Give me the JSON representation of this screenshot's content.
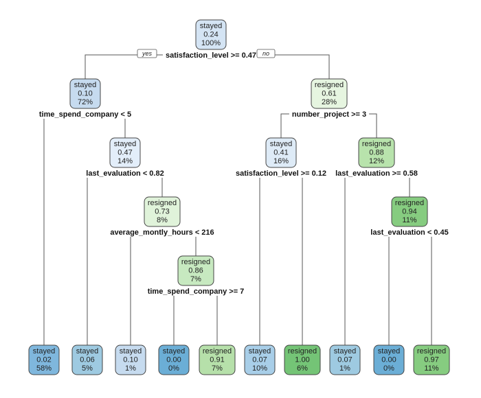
{
  "chart_data": {
    "type": "decision-tree",
    "title": "",
    "root_edge_labels": {
      "yes": "yes",
      "no": "no"
    },
    "class_colors": {
      "stayed": [
        "#e3eefa",
        "#cfe1f3",
        "#b3d1ea",
        "#9fc7e4",
        "#6aaed6"
      ],
      "resigned": [
        "#e8f6e3",
        "#d3efcb",
        "#b9e4ad",
        "#8fd182",
        "#6cc16a"
      ]
    },
    "nodes": [
      {
        "id": "n1",
        "class": "stayed",
        "prob": "0.24",
        "pct": "100%",
        "split": "satisfaction_level >= 0.47",
        "fill": "#d4e4f4"
      },
      {
        "id": "n2",
        "class": "stayed",
        "prob": "0.10",
        "pct": "72%",
        "split": "time_spend_company < 5",
        "fill": "#c6dbef",
        "parent": "n1"
      },
      {
        "id": "n3",
        "class": "resigned",
        "prob": "0.61",
        "pct": "28%",
        "split": "number_project >= 3",
        "fill": "#e6f5e0",
        "parent": "n1"
      },
      {
        "id": "n4",
        "class": "stayed",
        "prob": "0.02",
        "pct": "58%",
        "split": "",
        "fill": "#7fb7dd",
        "parent": "n2"
      },
      {
        "id": "n5",
        "class": "stayed",
        "prob": "0.47",
        "pct": "14%",
        "split": "last_evaluation < 0.82",
        "fill": "#e3eefa",
        "parent": "n2"
      },
      {
        "id": "n6",
        "class": "stayed",
        "prob": "0.41",
        "pct": "16%",
        "split": "satisfaction_level >= 0.12",
        "fill": "#deebf7",
        "parent": "n3"
      },
      {
        "id": "n7",
        "class": "resigned",
        "prob": "0.88",
        "pct": "12%",
        "split": "last_evaluation >= 0.58",
        "fill": "#b8e3ac",
        "parent": "n3"
      },
      {
        "id": "n8",
        "class": "stayed",
        "prob": "0.06",
        "pct": "5%",
        "split": "",
        "fill": "#9ecae1",
        "parent": "n5"
      },
      {
        "id": "n9",
        "class": "resigned",
        "prob": "0.73",
        "pct": "8%",
        "split": "average_montly_hours < 216",
        "fill": "#e0f3da",
        "parent": "n5"
      },
      {
        "id": "n10",
        "class": "stayed",
        "prob": "0.10",
        "pct": "1%",
        "split": "",
        "fill": "#c6dbef",
        "parent": "n9"
      },
      {
        "id": "n11",
        "class": "resigned",
        "prob": "0.86",
        "pct": "7%",
        "split": "time_spend_company >= 7",
        "fill": "#c7e9c0",
        "parent": "n9"
      },
      {
        "id": "n12",
        "class": "stayed",
        "prob": "0.00",
        "pct": "0%",
        "split": "",
        "fill": "#6baed6",
        "parent": "n11"
      },
      {
        "id": "n13",
        "class": "resigned",
        "prob": "0.91",
        "pct": "7%",
        "split": "",
        "fill": "#b6e0aa",
        "parent": "n11"
      },
      {
        "id": "n14",
        "class": "stayed",
        "prob": "0.07",
        "pct": "10%",
        "split": "",
        "fill": "#a8cee8",
        "parent": "n6"
      },
      {
        "id": "n15",
        "class": "resigned",
        "prob": "1.00",
        "pct": "6%",
        "split": "",
        "fill": "#74c476",
        "parent": "n6"
      },
      {
        "id": "n16",
        "class": "stayed",
        "prob": "0.07",
        "pct": "1%",
        "split": "",
        "fill": "#9ecae1",
        "parent": "n7"
      },
      {
        "id": "n17",
        "class": "resigned",
        "prob": "0.94",
        "pct": "11%",
        "split": "last_evaluation < 0.45",
        "fill": "#86cc80",
        "parent": "n7"
      },
      {
        "id": "n18",
        "class": "stayed",
        "prob": "0.00",
        "pct": "0%",
        "split": "",
        "fill": "#6baed6",
        "parent": "n17"
      },
      {
        "id": "n19",
        "class": "resigned",
        "prob": "0.97",
        "pct": "11%",
        "split": "",
        "fill": "#86cc80",
        "parent": "n17"
      }
    ]
  }
}
